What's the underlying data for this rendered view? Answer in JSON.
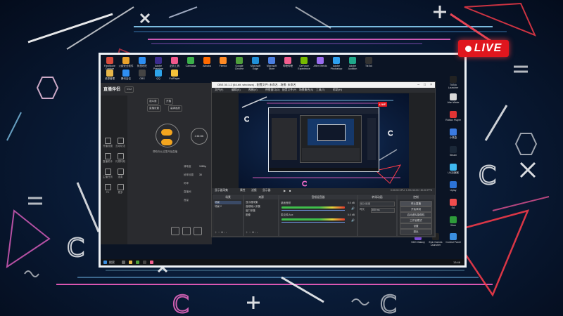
{
  "overlay": {
    "live_label": "LIVE"
  },
  "desktop": {
    "top_icons": [
      {
        "label": "FastStone Capture",
        "color": "#d94c3d"
      },
      {
        "label": "火绒安全软件",
        "color": "#e8a22c"
      },
      {
        "label": "阿里旺旺",
        "color": "#2c8ef2"
      },
      {
        "label": "Adobe Premiere",
        "color": "#3b2c8e"
      },
      {
        "label": "必剪工具",
        "color": "#f1588b"
      },
      {
        "label": "Camtasia",
        "color": "#3bb04a"
      },
      {
        "label": "Alibaba",
        "color": "#ff6a00"
      },
      {
        "label": "Firefox",
        "color": "#ff8a24"
      },
      {
        "label": "Google Chrome",
        "color": "#4f9f3b"
      },
      {
        "label": "Microsoft Edge",
        "color": "#1f8fd8"
      },
      {
        "label": "Microsoft Store",
        "color": "#4a7ee0"
      },
      {
        "label": "哔哩哔哩",
        "color": "#f25d8e"
      },
      {
        "label": "GeForce Experience",
        "color": "#76b900"
      },
      {
        "label": "After Effects",
        "color": "#9a6cf0"
      },
      {
        "label": "Adobe Photoshop",
        "color": "#2da0f0"
      },
      {
        "label": "Adobe Audition",
        "color": "#1fa88a"
      },
      {
        "label": "TikTok",
        "color": "#333333"
      }
    ],
    "second_row_icons": [
      {
        "label": "资源管理",
        "color": "#e6b64a"
      },
      {
        "label": "腾讯会议",
        "color": "#2f8ef0"
      },
      {
        "label": "OBS",
        "color": "#444444"
      },
      {
        "label": "QQ",
        "color": "#2ea4ea"
      },
      {
        "label": "PotPlayer",
        "color": "#f3c13a"
      }
    ],
    "right_icons": [
      {
        "label": "TikTok Launcher",
        "color": "#222222"
      },
      {
        "label": "Alan Wake",
        "color": "#d8d8d8"
      },
      {
        "label": "Roblox Player",
        "color": "#e03434"
      },
      {
        "label": "小黑盒",
        "color": "#3a7ae0"
      },
      {
        "label": "Steam",
        "color": "#1b2838"
      },
      {
        "label": "UU加速器",
        "color": "#3fb8f0"
      },
      {
        "label": "Uplay",
        "color": "#2c74d8"
      },
      {
        "label": "EA",
        "color": "#f04d4d"
      },
      {
        "label": "Xbox",
        "color": "#2e9b3a"
      }
    ],
    "bottom_right_icons": [
      {
        "label": "SDG Galaxy",
        "color": "#7a4ad8"
      },
      {
        "label": "Epic Games Launcher",
        "color": "#222222"
      },
      {
        "label": "Control Panel",
        "color": "#3a8ee0"
      }
    ],
    "bottom_left_icons": [
      {
        "label": "开始Copy.exe",
        "color": "#d33"
      },
      {
        "label": "ATM 加速器",
        "color": "#444"
      },
      {
        "label": "腾讯 2024",
        "color": "#2c8ef2"
      },
      {
        "label": "Razer",
        "color": "#3dd13d"
      },
      {
        "label": "回收站",
        "color": "#8aa6c8"
      },
      {
        "label": "设置",
        "color": "#6a6a6a"
      },
      {
        "label": "Win11 开始",
        "color": "#2f7ae0"
      }
    ]
  },
  "helper_app": {
    "title": "直播伴侣",
    "version_tag": "V3.2",
    "sidebar": [
      "开播设置",
      "互动玩法",
      "直播助手",
      "礼物特效",
      "主播任务",
      "连麦",
      "PK",
      "更多"
    ],
    "tags": [
      "观众席",
      "开播",
      "直播设置",
      "高清画质"
    ],
    "center_caption": "帮助你从这里开始直播",
    "labels": [
      "清晰度",
      "帧率设置",
      "码率",
      "直播间",
      "音量"
    ],
    "badge_text": "2.66 Mb",
    "values": [
      "1080p",
      "30"
    ]
  },
  "obs": {
    "title": "OBS 30.1.2 (64-bit, windows) - 配置文件: 未命名 - 场景: 未命名",
    "menu": [
      "文件(F)",
      "编辑(E)",
      "视图(V)",
      "停靠窗口(D)",
      "配置文件(P)",
      "场景集合(S)",
      "工具(T)",
      "帮助(H)"
    ],
    "preview_live": "LIVE",
    "toolbar_label": "显示器采集",
    "toolbar_props": "属性",
    "toolbar_filters": "滤镜",
    "toolbar_display": "显示器",
    "docks": {
      "scenes": {
        "title": "场景",
        "items": [
          "场景",
          "场景 2"
        ]
      },
      "sources": {
        "title": "来源",
        "items": [
          "显示器采集",
          "音频输入采集",
          "窗口采集",
          "图像"
        ]
      },
      "mixer": {
        "title": "音频混音器",
        "tracks": [
          {
            "name": "桌面音频",
            "db": "0.0 dB"
          },
          {
            "name": "麦克风/Aux",
            "db": "0.0 dB"
          }
        ]
      },
      "transitions": {
        "title": "转场动画",
        "type": "淡入淡出",
        "duration_label": "时长",
        "duration": "300 ms"
      },
      "controls": {
        "title": "控制",
        "buttons": [
          "停止直播",
          "开始录制",
          "启动虚拟摄像机",
          "工作室模式",
          "设置",
          "退出"
        ]
      }
    },
    "status": "0:00:00  CPU: 1.3%  30.00 / 30.00 FPS"
  },
  "taskbar": {
    "time": "13:46",
    "search": "搜索"
  }
}
